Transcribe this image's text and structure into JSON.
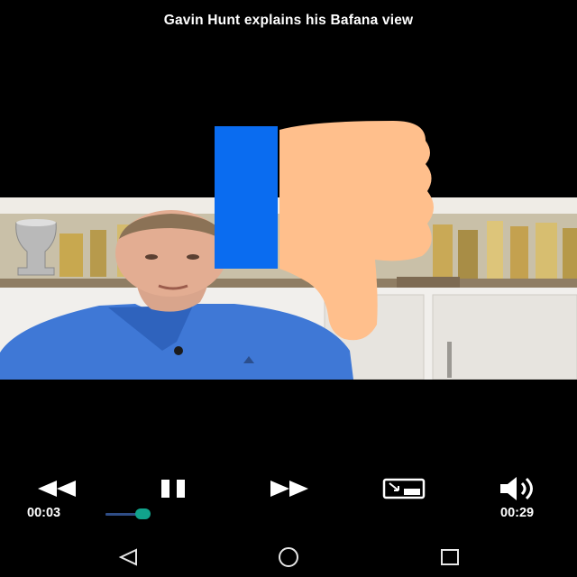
{
  "video": {
    "title": "Gavin Hunt explains his Bafana view"
  },
  "overlay": {
    "reaction": "thumbs-down-icon",
    "colors": {
      "cuff": "#0a6cf0",
      "hand": "#ffbf8c"
    }
  },
  "player": {
    "current_time": "00:03",
    "duration": "00:29",
    "progress_fraction": 0.1,
    "accent_color": "#11a38c",
    "buttons": {
      "rewind": "rewind-icon",
      "pause": "pause-icon",
      "fast_forward": "fast-forward-icon",
      "pip": "picture-in-picture-icon",
      "volume": "volume-icon"
    }
  },
  "navbar": {
    "back": "back-triangle-icon",
    "home": "home-circle-icon",
    "recents": "recents-square-icon"
  }
}
